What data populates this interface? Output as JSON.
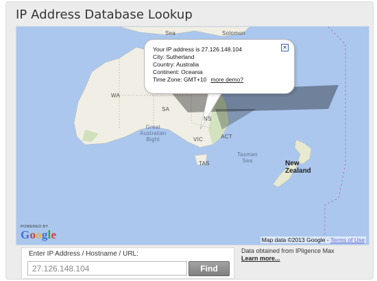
{
  "header": {
    "title": "IP Address Database Lookup"
  },
  "map": {
    "labels": {
      "sea": "Sea",
      "solomon": "Solomon",
      "wa": "WA",
      "sa": "SA",
      "nsw": "NS",
      "great_bight": "Great\nAustralian\nBight",
      "vic": "VIC",
      "act": "ACT",
      "tasman_sea": "Tasman\nSea",
      "tas": "TAS",
      "new_zealand": "New\nZealand"
    },
    "logo": {
      "powered_by": "POWERED BY",
      "word": "Google"
    },
    "attribution": {
      "text": "Map data ©2013 Google -",
      "terms": "Terms of Use"
    },
    "colors": {
      "water": "#abc7ee",
      "land": "#f1efe5",
      "green": "#cfe1bb"
    }
  },
  "info_window": {
    "line1": "Your IP address is 27.126.148.104",
    "line2": "City: Sutherland",
    "line3": "Country: Australia",
    "line4": "Continent: Oceania",
    "line5": "Time Zone: GMT+10",
    "more_demo": "more demo?",
    "close_icon": "close-icon"
  },
  "lookup": {
    "label": "Enter IP Address / Hostname / URL:",
    "value": "27.126.148.104",
    "find_label": "Find"
  },
  "footer": {
    "data_source": "Data obtained from IPligence Max",
    "learn_more": "Learn more..."
  }
}
